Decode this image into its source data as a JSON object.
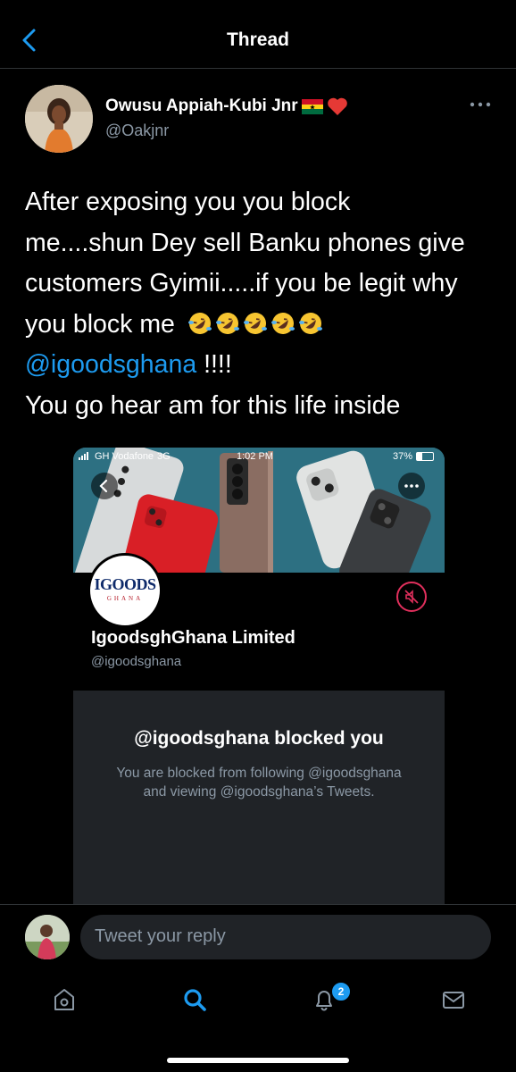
{
  "header": {
    "title": "Thread"
  },
  "tweet": {
    "author_name": "Owusu Appiah-Kubi Jnr",
    "author_handle": "@Oakjnr",
    "text_line1": "After exposing you you block",
    "text_line2": "me....shun Dey sell Banku phones give",
    "text_line3": "customers Gyimii.....if you be legit why",
    "text_line4": "you block me",
    "mention": "@igoodsghana",
    "mention_suffix": " !!!!",
    "text_line6": "You go hear am for this life inside"
  },
  "embedded_screenshot": {
    "status_carrier": "GH Vodafone",
    "status_network": "3G",
    "status_time": "1:02 PM",
    "status_battery": "37%",
    "logo_text": "IGOODS",
    "logo_sub": "GHANA",
    "profile_name": "IgoodsghGhana Limited",
    "profile_handle": "@igoodsghana",
    "blocked_title": "@igoodsghana blocked you",
    "blocked_desc": "You are blocked from following @igoodsghana and viewing @igoodsghana’s Tweets."
  },
  "reply": {
    "placeholder": "Tweet your reply"
  },
  "nav": {
    "notifications_badge": "2"
  },
  "colors": {
    "accent": "#1d9bf0",
    "background": "#000000",
    "muted": "#8b98a5",
    "block_box": "#202327",
    "mute_red": "#e02f5c"
  }
}
